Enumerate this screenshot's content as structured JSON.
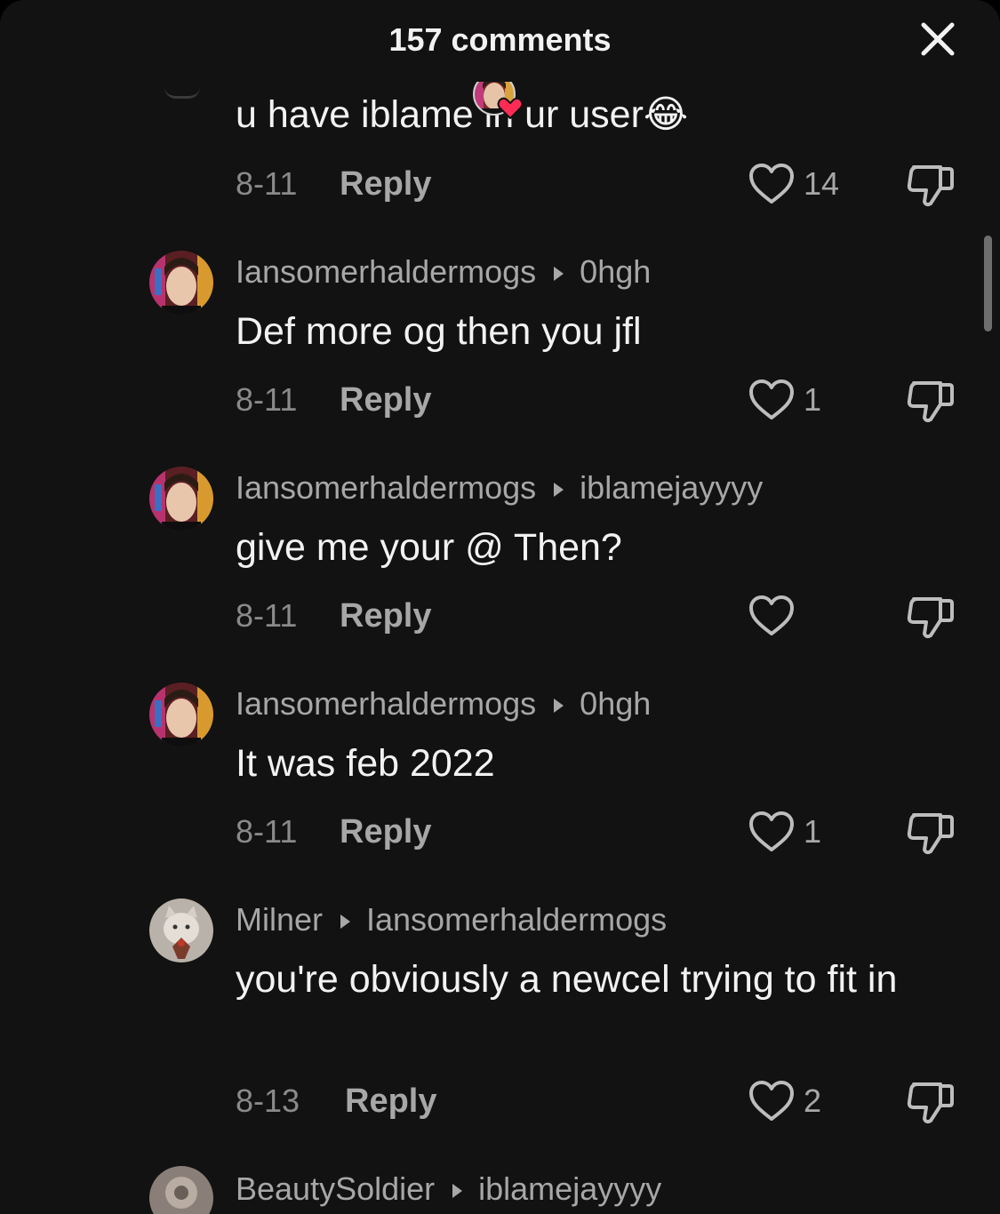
{
  "header": {
    "title": "157 comments"
  },
  "comments": [
    {
      "text": "u have iblame in ur user😂",
      "date": "8-11",
      "reply_label": "Reply",
      "likes": "14"
    },
    {
      "user": "Iansomerhaldermogs",
      "reply_to": "0hgh",
      "text": "Def more og then you jfl",
      "date": "8-11",
      "reply_label": "Reply",
      "likes": "1"
    },
    {
      "user": "Iansomerhaldermogs",
      "reply_to": "iblamejayyyy",
      "text": "give me your @ Then?",
      "date": "8-11",
      "reply_label": "Reply",
      "likes": ""
    },
    {
      "user": "Iansomerhaldermogs",
      "reply_to": "0hgh",
      "text": "It was feb 2022",
      "date": "8-11",
      "reply_label": "Reply",
      "likes": "1"
    },
    {
      "user": "Milner",
      "reply_to": "Iansomerhaldermogs",
      "text": "you're obviously a newcel trying to fit in",
      "date": "8-13",
      "reply_label": "Reply",
      "likes": "2"
    },
    {
      "user": "BeautySoldier",
      "reply_to": "iblamejayyyy"
    }
  ],
  "icons": {
    "close": "close-icon",
    "like": "heart-outline-icon",
    "dislike": "thumbs-down-icon",
    "reply_arrow": "play-triangle-icon",
    "creator_liked": "creator-liked-heart-icon"
  },
  "colors": {
    "background": "#121212",
    "primary_text": "#f2f2f2",
    "secondary_text": "#a7a7a7",
    "liked_heart": "#fe2c55"
  }
}
